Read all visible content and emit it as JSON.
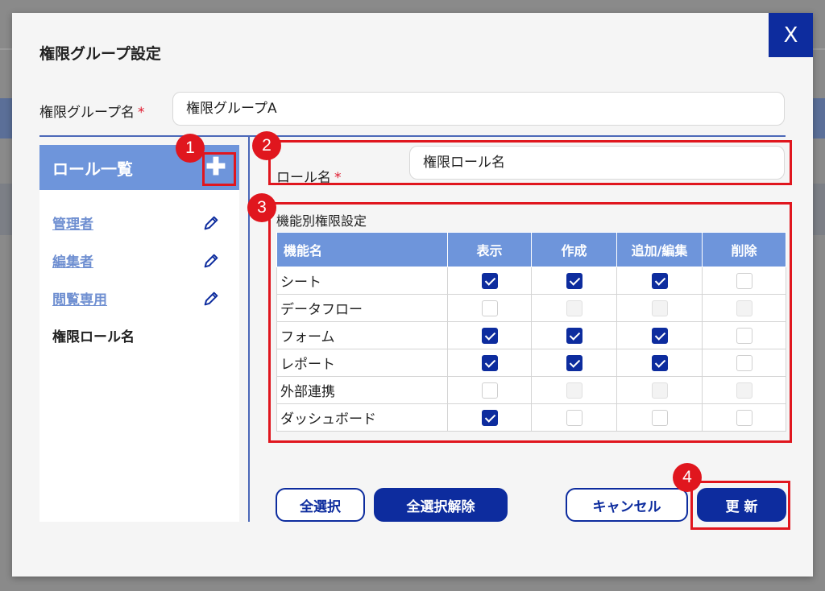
{
  "dialog": {
    "title": "権限グループ設定",
    "close_label": "X"
  },
  "group": {
    "label": "権限グループ名",
    "required_mark": "*",
    "value": "権限グループA"
  },
  "roles": {
    "header": "ロール一覧",
    "add_label": "✚",
    "items": [
      {
        "label": "管理者",
        "editable": true
      },
      {
        "label": "編集者",
        "editable": true
      },
      {
        "label": "閲覧専用",
        "editable": true
      },
      {
        "label": "権限ロール名",
        "editable": false
      }
    ]
  },
  "role_form": {
    "label": "ロール名",
    "required_mark": "*",
    "value": "権限ロール名"
  },
  "permissions": {
    "title": "機能別権限設定",
    "columns": [
      "機能名",
      "表示",
      "作成",
      "追加/編集",
      "削除"
    ],
    "rows": [
      {
        "name": "シート",
        "cells": [
          "on",
          "on",
          "on",
          "off"
        ]
      },
      {
        "name": "データフロー",
        "cells": [
          "off",
          "dis",
          "dis",
          "dis"
        ]
      },
      {
        "name": "フォーム",
        "cells": [
          "on",
          "on",
          "on",
          "off"
        ]
      },
      {
        "name": "レポート",
        "cells": [
          "on",
          "on",
          "on",
          "off"
        ]
      },
      {
        "name": "外部連携",
        "cells": [
          "off",
          "dis",
          "dis",
          "dis"
        ]
      },
      {
        "name": "ダッシュボード",
        "cells": [
          "on",
          "off",
          "off",
          "off"
        ]
      }
    ]
  },
  "buttons": {
    "select_all": "全選択",
    "deselect_all": "全選択解除",
    "cancel": "キャンセル",
    "update": "更 新"
  },
  "annotations": {
    "badge1": "1",
    "badge2": "2",
    "badge3": "3",
    "badge4": "4"
  },
  "colors": {
    "accent": "#0d2c9e",
    "header_blue": "#6e95db",
    "annotation_red": "#e0161e"
  }
}
